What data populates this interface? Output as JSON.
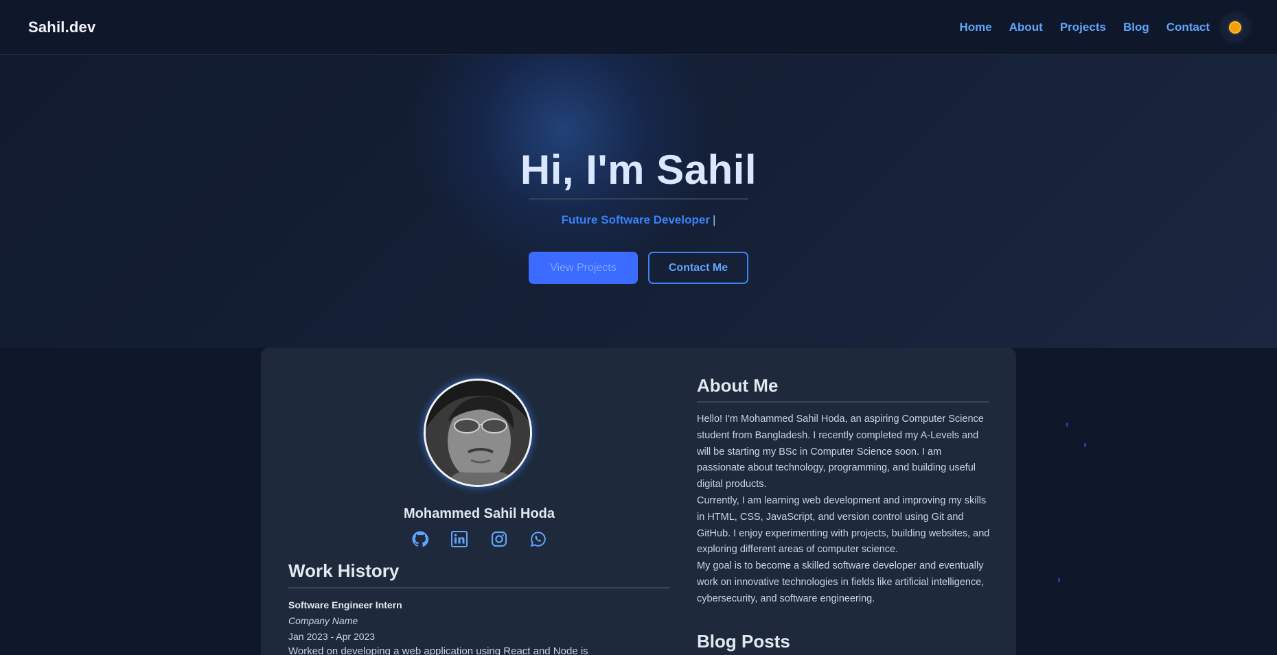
{
  "nav": {
    "brand": "Sahil.dev",
    "links": [
      "Home",
      "About",
      "Projects",
      "Blog",
      "Contact"
    ],
    "theme_toggle_icon": "sun-icon"
  },
  "hero": {
    "title": "Hi, I'm Sahil",
    "subtitle": "Future Software Developer",
    "cursor": "|",
    "primary_button": "View Projects",
    "secondary_button": "Contact Me"
  },
  "profile": {
    "name": "Mohammed Sahil Hoda",
    "socials": [
      "github-icon",
      "linkedin-icon",
      "instagram-icon",
      "whatsapp-icon"
    ]
  },
  "work": {
    "title": "Work History",
    "role": "Software Engineer Intern",
    "company": "Company Name",
    "dates": "Jan 2023 - Apr 2023",
    "description": "Worked on developing a web application using React and Node is"
  },
  "about": {
    "title": "About Me",
    "para1": "Hello! I'm Mohammed Sahil Hoda, an aspiring Computer Science student from Bangladesh. I recently completed my A-Levels and will be starting my BSc in Computer Science soon. I am passionate about technology, programming, and building useful digital products.",
    "para2": "Currently, I am learning web development and improving my skills in HTML, CSS, JavaScript, and version control using Git and GitHub. I enjoy experimenting with projects, building websites, and exploring different areas of computer science.",
    "para3": "My goal is to become a skilled software developer and eventually work on innovative technologies in fields like artificial intelligence, cybersecurity, and software engineering."
  },
  "blog": {
    "title": "Blog Posts"
  },
  "colors": {
    "accent": "#3b82f6",
    "background": "#0f172a",
    "card": "#1e293b"
  }
}
